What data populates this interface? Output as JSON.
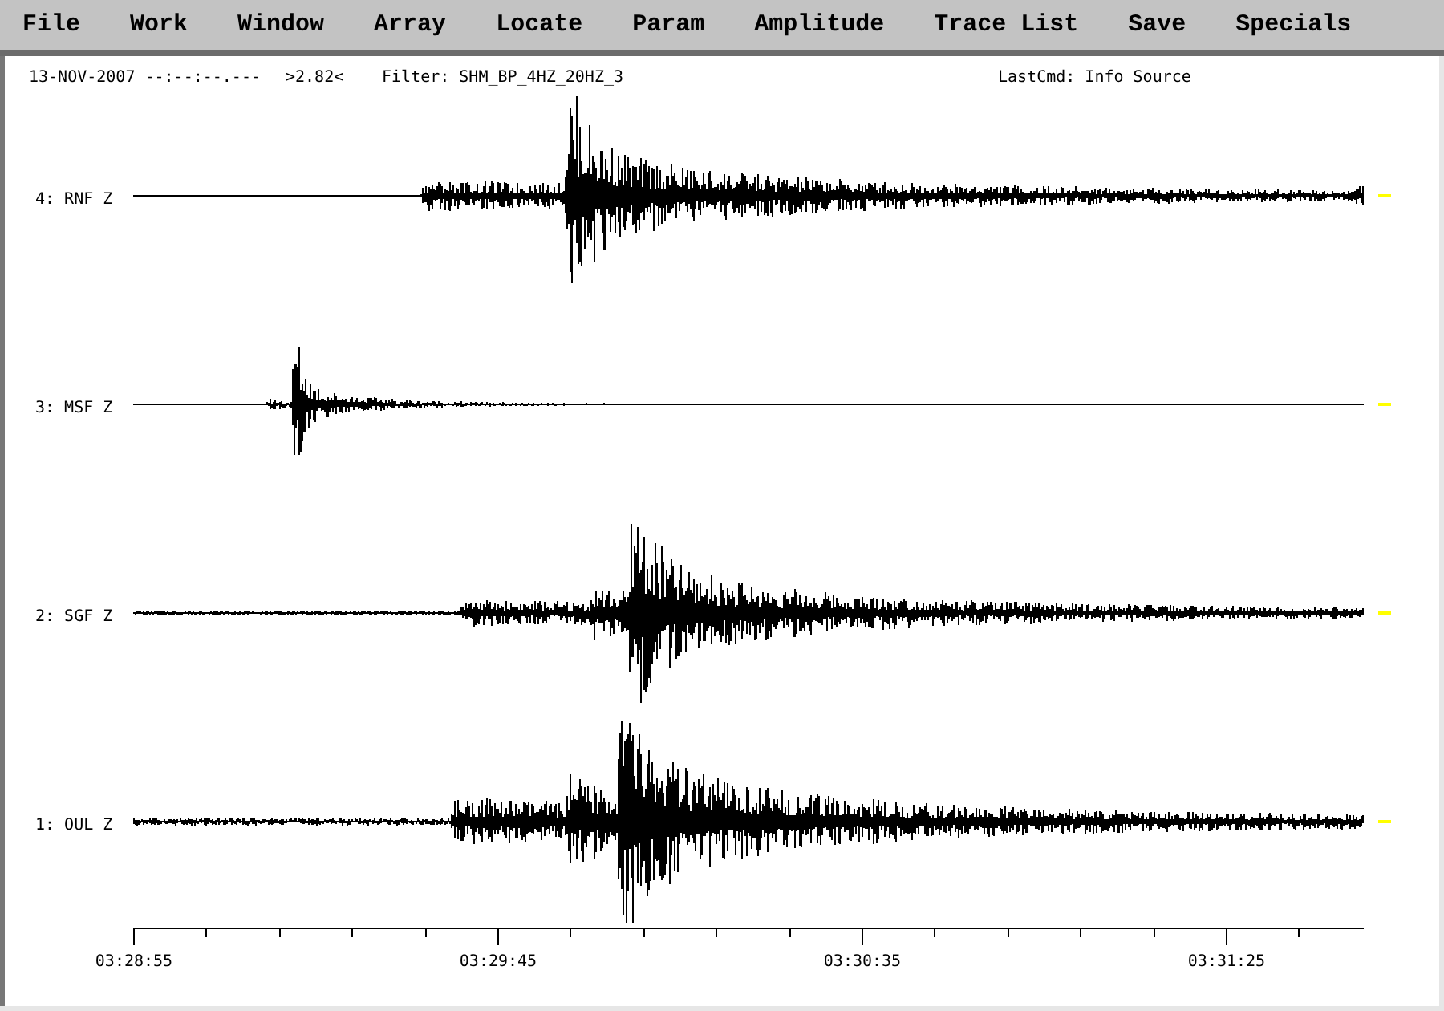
{
  "menu": [
    "File",
    "Work",
    "Window",
    "Array",
    "Locate",
    "Param",
    "Amplitude",
    "Trace List",
    "Save",
    "Specials"
  ],
  "header": {
    "date_time": "13-NOV-2007 --:--:--.---",
    "amplitude": ">2.82<",
    "filter": "Filter: SHM_BP_4HZ_20HZ_3",
    "last_command": "LastCmd: Info Source"
  },
  "traces": [
    {
      "label": "4: RNF Z"
    },
    {
      "label": "3: MSF Z"
    },
    {
      "label": "2: SGF Z"
    },
    {
      "label": "1: OUL Z"
    }
  ],
  "time_axis": {
    "labels": [
      "03:28:55",
      "03:29:45",
      "03:30:35",
      "03:31:25"
    ]
  }
}
